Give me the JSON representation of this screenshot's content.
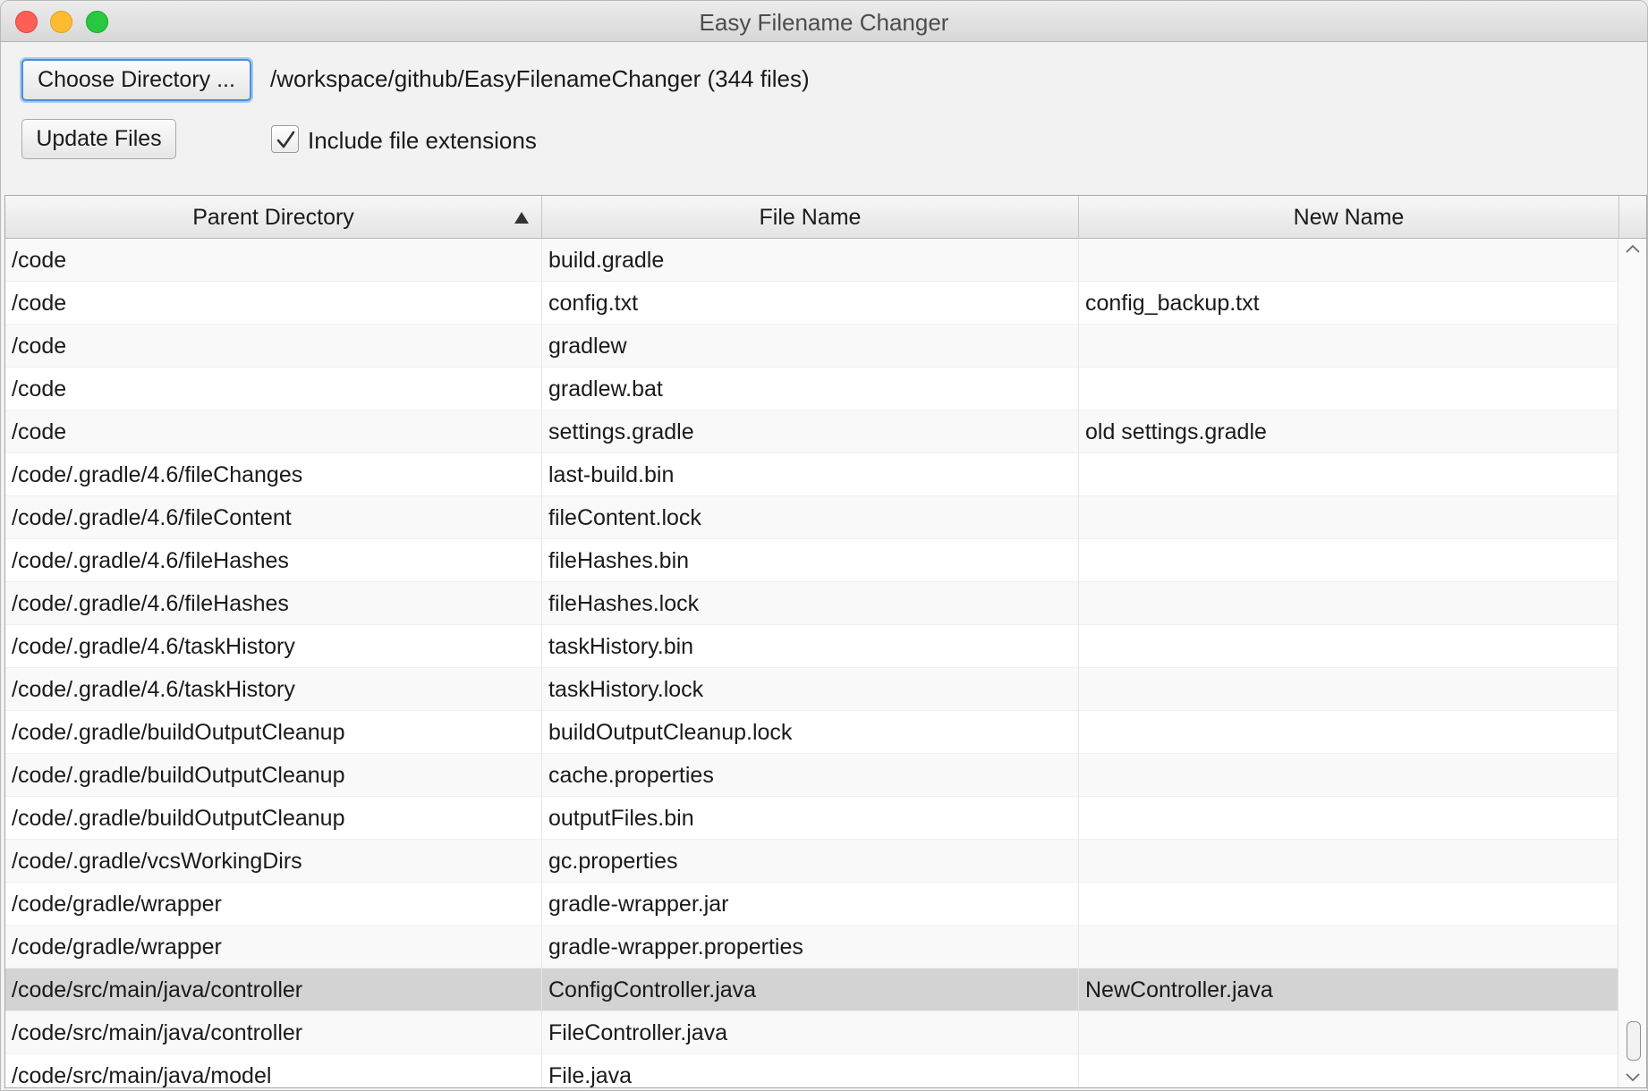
{
  "window": {
    "title": "Easy Filename Changer"
  },
  "toolbar": {
    "choose_label": "Choose Directory ...",
    "path_label": "/workspace/github/EasyFilenameChanger (344 files)",
    "update_label": "Update Files",
    "include_ext_label": "Include file extensions",
    "include_ext_checked": true
  },
  "table": {
    "columns": [
      "Parent Directory",
      "File Name",
      "New Name"
    ],
    "sort_column": "Parent Directory",
    "sort_direction": "ascending",
    "rows": [
      {
        "parent": "/code",
        "file": "build.gradle",
        "new": ""
      },
      {
        "parent": "/code",
        "file": "config.txt",
        "new": "config_backup.txt"
      },
      {
        "parent": "/code",
        "file": "gradlew",
        "new": ""
      },
      {
        "parent": "/code",
        "file": "gradlew.bat",
        "new": ""
      },
      {
        "parent": "/code",
        "file": "settings.gradle",
        "new": "old settings.gradle"
      },
      {
        "parent": "/code/.gradle/4.6/fileChanges",
        "file": "last-build.bin",
        "new": ""
      },
      {
        "parent": "/code/.gradle/4.6/fileContent",
        "file": "fileContent.lock",
        "new": ""
      },
      {
        "parent": "/code/.gradle/4.6/fileHashes",
        "file": "fileHashes.bin",
        "new": ""
      },
      {
        "parent": "/code/.gradle/4.6/fileHashes",
        "file": "fileHashes.lock",
        "new": ""
      },
      {
        "parent": "/code/.gradle/4.6/taskHistory",
        "file": "taskHistory.bin",
        "new": ""
      },
      {
        "parent": "/code/.gradle/4.6/taskHistory",
        "file": "taskHistory.lock",
        "new": ""
      },
      {
        "parent": "/code/.gradle/buildOutputCleanup",
        "file": "buildOutputCleanup.lock",
        "new": ""
      },
      {
        "parent": "/code/.gradle/buildOutputCleanup",
        "file": "cache.properties",
        "new": ""
      },
      {
        "parent": "/code/.gradle/buildOutputCleanup",
        "file": "outputFiles.bin",
        "new": ""
      },
      {
        "parent": "/code/.gradle/vcsWorkingDirs",
        "file": "gc.properties",
        "new": ""
      },
      {
        "parent": "/code/gradle/wrapper",
        "file": "gradle-wrapper.jar",
        "new": ""
      },
      {
        "parent": "/code/gradle/wrapper",
        "file": "gradle-wrapper.properties",
        "new": ""
      },
      {
        "parent": "/code/src/main/java/controller",
        "file": "ConfigController.java",
        "new": "NewController.java",
        "selected": true
      },
      {
        "parent": "/code/src/main/java/controller",
        "file": "FileController.java",
        "new": ""
      },
      {
        "parent": "/code/src/main/java/model",
        "file": "File.java",
        "new": ""
      }
    ]
  },
  "icons": {
    "sort": "sort-ascending-icon",
    "checkbox": "checkmark-icon",
    "scroll_up": "chevron-up-icon",
    "scroll_down": "chevron-down-icon"
  },
  "colors": {
    "focus_ring": "#4a90d9",
    "selected_row": "#d3d3d3",
    "close": "#fd5f57",
    "minimize": "#febc2e",
    "maximize": "#28c840"
  }
}
